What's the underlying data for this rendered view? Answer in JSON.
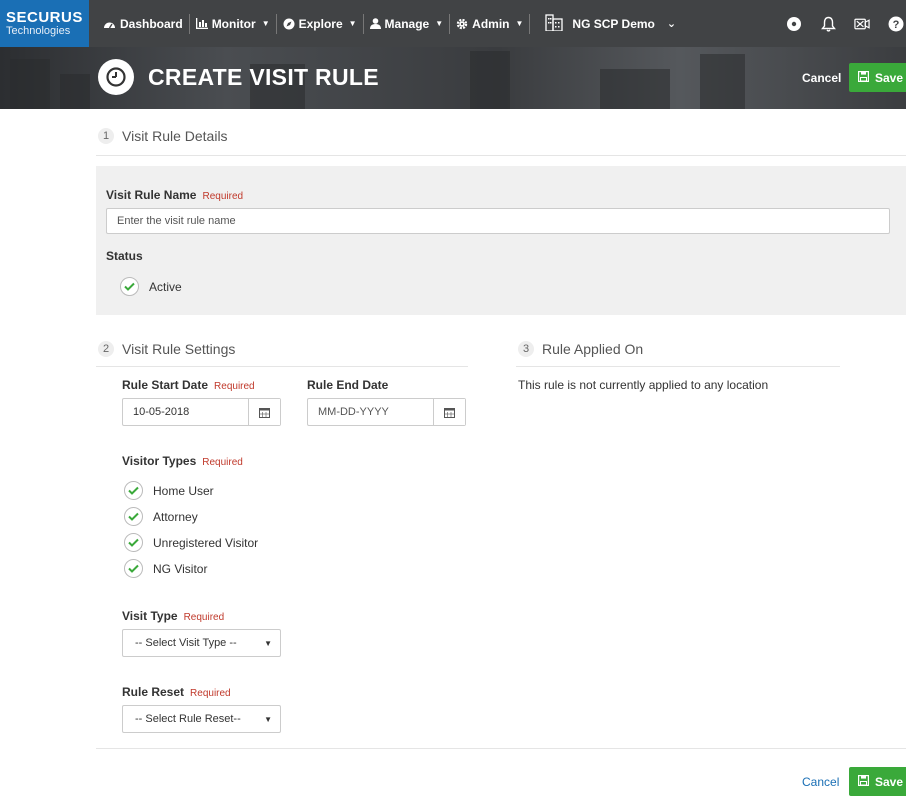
{
  "brand": {
    "line1": "SECURUS",
    "line2": "Technologies"
  },
  "nav": {
    "items": [
      {
        "label": "Dashboard",
        "icon": "dashboard-icon",
        "dropdown": false
      },
      {
        "label": "Monitor",
        "icon": "bar-chart-icon",
        "dropdown": true
      },
      {
        "label": "Explore",
        "icon": "compass-icon",
        "dropdown": true
      },
      {
        "label": "Manage",
        "icon": "user-icon",
        "dropdown": true
      },
      {
        "label": "Admin",
        "icon": "gear-icon",
        "dropdown": true
      }
    ],
    "org": "NG SCP Demo"
  },
  "header": {
    "title": "CREATE VISIT RULE",
    "cancel_label": "Cancel",
    "save_label": "Save"
  },
  "section1": {
    "number": "1",
    "title": "Visit Rule Details",
    "name_label": "Visit Rule Name",
    "name_required": "Required",
    "name_placeholder": "Enter the visit rule name",
    "status_label": "Status",
    "status_option": "Active"
  },
  "section2": {
    "number": "2",
    "title": "Visit Rule Settings",
    "start_label": "Rule Start Date",
    "start_required": "Required",
    "start_value": "10-05-2018",
    "end_label": "Rule End Date",
    "end_placeholder": "MM-DD-YYYY",
    "visitor_types_label": "Visitor Types",
    "visitor_types_required": "Required",
    "visitor_types": [
      "Home User",
      "Attorney",
      "Unregistered Visitor",
      "NG Visitor"
    ],
    "visit_type_label": "Visit Type",
    "visit_type_required": "Required",
    "visit_type_value": "-- Select Visit Type --",
    "rule_reset_label": "Rule Reset",
    "rule_reset_required": "Required",
    "rule_reset_value": "-- Select Rule Reset--"
  },
  "section3": {
    "number": "3",
    "title": "Rule Applied On",
    "message": "This rule is not currently applied to any location"
  },
  "footer": {
    "cancel_label": "Cancel",
    "save_label": "Save"
  },
  "colors": {
    "brand_blue": "#1a6fb5",
    "save_green": "#3aa93a",
    "check_green": "#3aa93a",
    "required_red": "#c0392b"
  }
}
